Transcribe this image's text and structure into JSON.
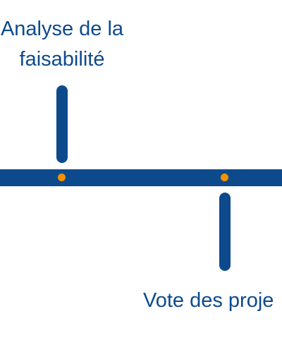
{
  "timeline": {
    "milestones": [
      {
        "label_lines": [
          "Analyse de la",
          "faisabilité"
        ],
        "position": "above"
      },
      {
        "label": "Vote des proje",
        "position": "below"
      }
    ],
    "colors": {
      "line": "#0d4a8c",
      "dot": "#f39200",
      "text": "#0d4a8c"
    }
  }
}
